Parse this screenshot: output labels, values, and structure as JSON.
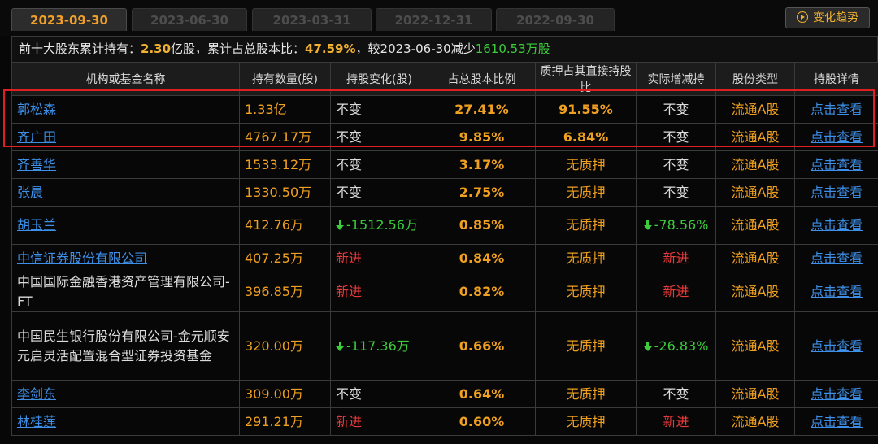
{
  "tabs": [
    {
      "label": "2023-09-30",
      "active": true
    },
    {
      "label": "2023-06-30",
      "active": false
    },
    {
      "label": "2023-03-31",
      "active": false
    },
    {
      "label": "2022-12-31",
      "active": false
    },
    {
      "label": "2022-09-30",
      "active": false
    }
  ],
  "trend_button": {
    "label": "变化趋势",
    "icon": "play-circle-icon"
  },
  "summary": {
    "prefix": "前十大股东累计持有：",
    "total_shares": "2.30",
    "shares_unit": "亿股，累计占总股本比：",
    "total_ratio": "47.59%",
    "compare_text": "，较2023-06-30减少",
    "decrease": "1610.53万股"
  },
  "columns": [
    "机构或基金名称",
    "持有数量(股)",
    "持股变化(股)",
    "占总股本比例",
    "质押占其直接持股比",
    "实际增减持",
    "股份类型",
    "持股详情"
  ],
  "rows": [
    {
      "name": "郭松森",
      "link": true,
      "qty": "1.33亿",
      "chg": "不变",
      "chg_type": "same",
      "pct": "27.41%",
      "pledge": "91.55%",
      "act": "不变",
      "act_type": "same",
      "stype": "流通A股",
      "detail": "点击查看"
    },
    {
      "name": "齐广田",
      "link": true,
      "qty": "4767.17万",
      "chg": "不变",
      "chg_type": "same",
      "pct": "9.85%",
      "pledge": "6.84%",
      "act": "不变",
      "act_type": "same",
      "stype": "流通A股",
      "detail": "点击查看"
    },
    {
      "name": "齐善华",
      "link": true,
      "qty": "1533.12万",
      "chg": "不变",
      "chg_type": "same",
      "pct": "3.17%",
      "pledge": "无质押",
      "act": "不变",
      "act_type": "same",
      "stype": "流通A股",
      "detail": "点击查看"
    },
    {
      "name": "张晨",
      "link": true,
      "qty": "1330.50万",
      "chg": "不变",
      "chg_type": "same",
      "pct": "2.75%",
      "pledge": "无质押",
      "act": "不变",
      "act_type": "same",
      "stype": "流通A股",
      "detail": "点击查看"
    },
    {
      "name": "胡玉兰",
      "link": true,
      "qty": "412.76万",
      "chg": "-1512.56万",
      "chg_type": "down",
      "pct": "0.85%",
      "pledge": "无质押",
      "act": "-78.56%",
      "act_type": "down",
      "stype": "流通A股",
      "detail": "点击查看"
    },
    {
      "name": "中信证券股份有限公司",
      "link": true,
      "qty": "407.25万",
      "chg": "新进",
      "chg_type": "new",
      "pct": "0.84%",
      "pledge": "无质押",
      "act": "新进",
      "act_type": "new",
      "stype": "流通A股",
      "detail": "点击查看"
    },
    {
      "name": "中国国际金融香港资产管理有限公司-FT",
      "link": false,
      "qty": "396.85万",
      "chg": "新进",
      "chg_type": "new",
      "pct": "0.82%",
      "pledge": "无质押",
      "act": "新进",
      "act_type": "new",
      "stype": "流通A股",
      "detail": "点击查看"
    },
    {
      "name": "中国民生银行股份有限公司-金元顺安元启灵活配置混合型证券投资基金",
      "link": false,
      "qty": "320.00万",
      "chg": "-117.36万",
      "chg_type": "down",
      "pct": "0.66%",
      "pledge": "无质押",
      "act": "-26.83%",
      "act_type": "down",
      "stype": "流通A股",
      "detail": "点击查看"
    },
    {
      "name": "李剑东",
      "link": true,
      "qty": "309.00万",
      "chg": "不变",
      "chg_type": "same",
      "pct": "0.64%",
      "pledge": "无质押",
      "act": "不变",
      "act_type": "same",
      "stype": "流通A股",
      "detail": "点击查看"
    },
    {
      "name": "林桂莲",
      "link": true,
      "qty": "291.21万",
      "chg": "新进",
      "chg_type": "new",
      "pct": "0.60%",
      "pledge": "无质押",
      "act": "新进",
      "act_type": "new",
      "stype": "流通A股",
      "detail": "点击查看"
    }
  ],
  "colors": {
    "accent": "#f0a020",
    "link": "#3d8fe8",
    "up_new": "#e83a3a",
    "down": "#3ccc3c",
    "highlight_box": "#e02020"
  }
}
